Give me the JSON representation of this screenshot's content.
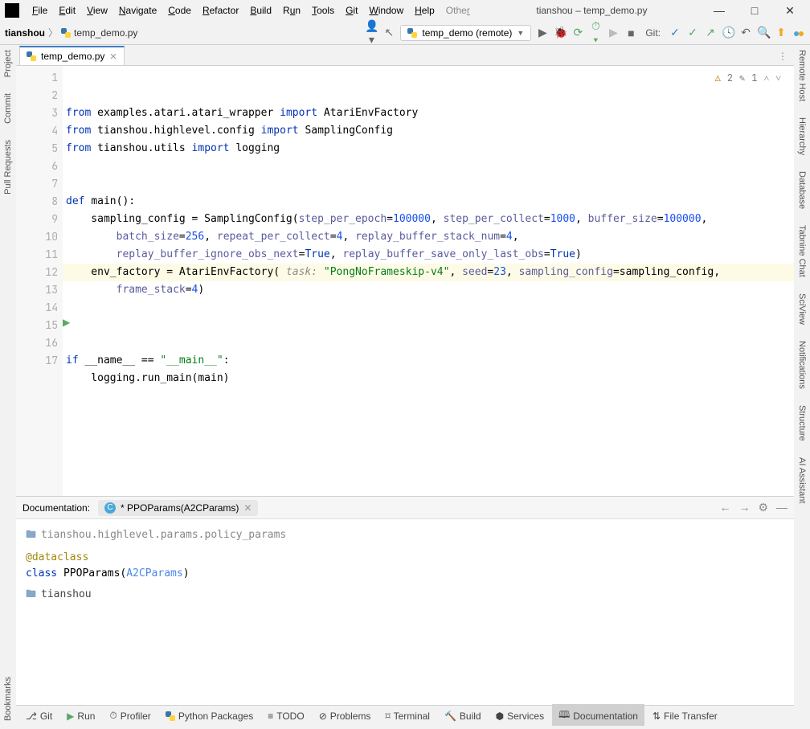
{
  "title": "tianshou – temp_demo.py",
  "menu": [
    "File",
    "Edit",
    "View",
    "Navigate",
    "Code",
    "Refactor",
    "Build",
    "Run",
    "Tools",
    "Git",
    "Window",
    "Help",
    "Other"
  ],
  "breadcrumb": {
    "project": "tianshou",
    "file": "temp_demo.py"
  },
  "run_config": "temp_demo (remote)",
  "git_label": "Git:",
  "tab": {
    "name": "temp_demo.py"
  },
  "inspections": {
    "warnings": "2",
    "typos": "1"
  },
  "gutter_lines": [
    "1",
    "2",
    "3",
    "4",
    "5",
    "6",
    "7",
    "8",
    "9",
    "10",
    "11",
    "12",
    "13",
    "14",
    "15",
    "16",
    "17"
  ],
  "code": {
    "l1": {
      "a": "from ",
      "b": "examples.atari.atari_wrapper ",
      "c": "import ",
      "d": "AtariEnvFactory"
    },
    "l2": {
      "a": "from ",
      "b": "tianshou.highlevel.config ",
      "c": "import ",
      "d": "SamplingConfig"
    },
    "l3": {
      "a": "from ",
      "b": "tianshou.utils ",
      "c": "import ",
      "d": "logging"
    },
    "l6": {
      "a": "def ",
      "b": "main",
      "c": "():"
    },
    "l7": {
      "a": "    sampling_config = SamplingConfig(",
      "p1": "step_per_epoch",
      "e1": "=",
      "v1": "100000",
      "c1": ", ",
      "p2": "step_per_collect",
      "e2": "=",
      "v2": "1000",
      "c2": ", ",
      "p3": "buffer_size",
      "e3": "=",
      "v3": "100000",
      "end": ","
    },
    "l8": {
      "a": "        ",
      "p1": "batch_size",
      "e1": "=",
      "v1": "256",
      "c1": ", ",
      "p2": "repeat_per_collect",
      "e2": "=",
      "v2": "4",
      "c2": ", ",
      "p3": "replay_buffer_stack_num",
      "e3": "=",
      "v3": "4",
      "end": ","
    },
    "l9": {
      "a": "        ",
      "p1": "replay_buffer_ignore_obs_next",
      "e1": "=",
      "v1": "True",
      "c1": ", ",
      "p2": "replay_buffer_save_only_last_obs",
      "e2": "=",
      "v2": "True",
      "end": ")"
    },
    "l10": {
      "a": "    env_factory = AtariEnvFactory( ",
      "hint": "task: ",
      "str": "\"PongNoFrameskip-v4\"",
      "c1": ", ",
      "p1": "seed",
      "e1": "=",
      "v1": "23",
      "c2": ", ",
      "p2": "sampling_config",
      "e2": "=sampling_config,",
      "end": ""
    },
    "l11": {
      "a": "        ",
      "p1": "frame_stack",
      "e1": "=",
      "v1": "4",
      "end": ")"
    },
    "l15": {
      "a": "if ",
      "b": "__name__ == ",
      "str": "\"__main__\"",
      "c": ":"
    },
    "l16": {
      "a": "    logging.run_main(main)"
    }
  },
  "doc": {
    "label": "Documentation:",
    "tab": "* PPOParams(A2CParams)",
    "path": "tianshou.highlevel.params.policy_params",
    "decorator": "@dataclass",
    "cls_kw": "class ",
    "cls_name": "PPOParams",
    "paren_open": "(",
    "parent": "A2CParams",
    "paren_close": ")",
    "pkg": "tianshou"
  },
  "left_tools": [
    "Project",
    "Commit",
    "Pull Requests",
    "Bookmarks"
  ],
  "right_tools": [
    "Remote Host",
    "Hierarchy",
    "Database",
    "Tabnine Chat",
    "SciView",
    "Notifications",
    "Structure",
    "AI Assistant"
  ],
  "bottom": [
    "Git",
    "Run",
    "Profiler",
    "Python Packages",
    "TODO",
    "Problems",
    "Terminal",
    "Build",
    "Services",
    "Documentation",
    "File Transfer"
  ]
}
